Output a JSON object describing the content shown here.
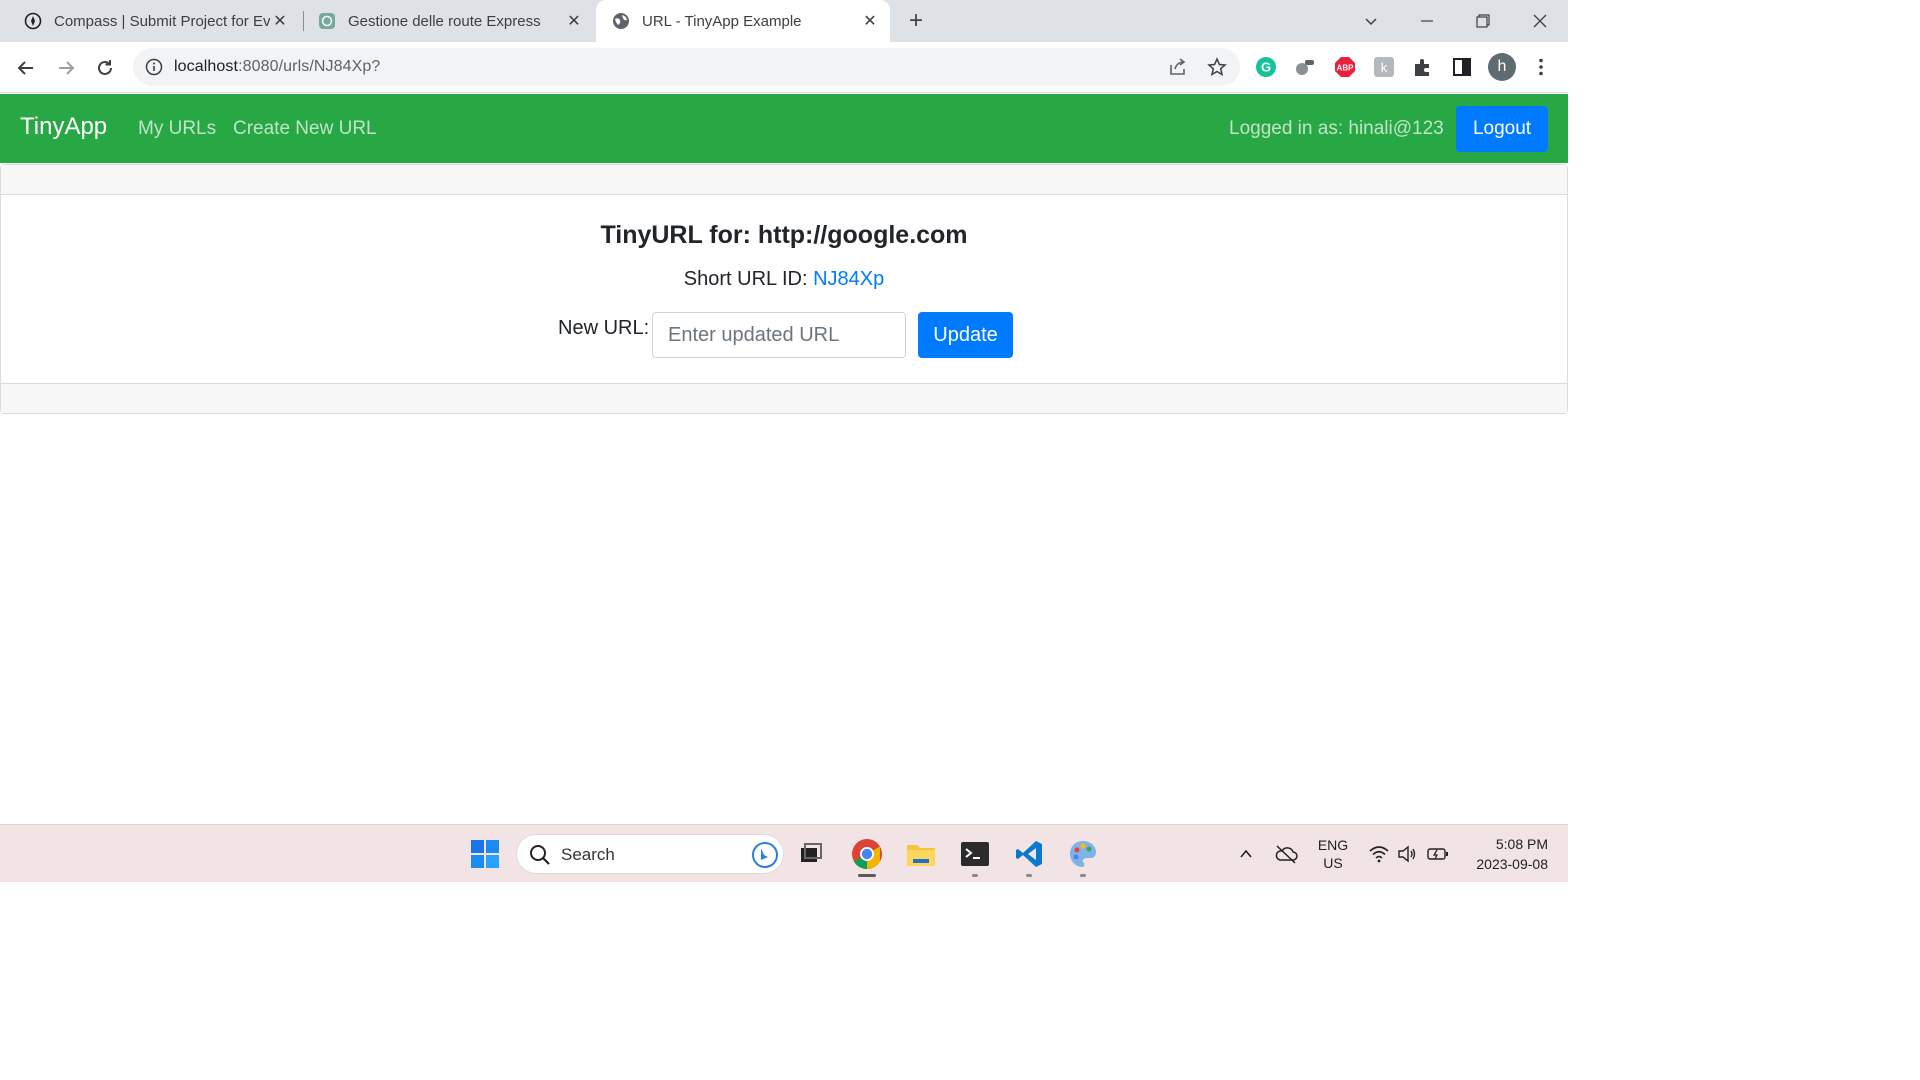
{
  "browser": {
    "tabs": [
      {
        "title": "Compass | Submit Project for Eva",
        "icon": "compass-icon",
        "active": false
      },
      {
        "title": "Gestione delle route Express",
        "icon": "openai-icon",
        "active": false
      },
      {
        "title": "URL - TinyApp Example",
        "icon": "globe-icon",
        "active": true
      }
    ],
    "address": {
      "host": "localhost",
      "path": ":8080/urls/NJ84Xp?"
    },
    "profile_initial": "h"
  },
  "app": {
    "brand": "TinyApp",
    "nav": {
      "my_urls": "My URLs",
      "create_new": "Create New URL"
    },
    "logged_in_text": "Logged in as: hinali@123",
    "logout_label": "Logout",
    "card": {
      "title": "TinyURL for: http://google.com",
      "short_prefix": "Short URL ID: ",
      "short_id": "NJ84Xp",
      "new_url_label": "New URL:",
      "new_url_value": "",
      "new_url_placeholder": "Enter updated URL",
      "update_label": "Update"
    },
    "colors": {
      "navbar": "#28a745",
      "primary": "#007bff"
    }
  },
  "taskbar": {
    "search_label": "Search",
    "lang_top": "ENG",
    "lang_bottom": "US",
    "time": "5:08 PM",
    "date": "2023-09-08"
  }
}
